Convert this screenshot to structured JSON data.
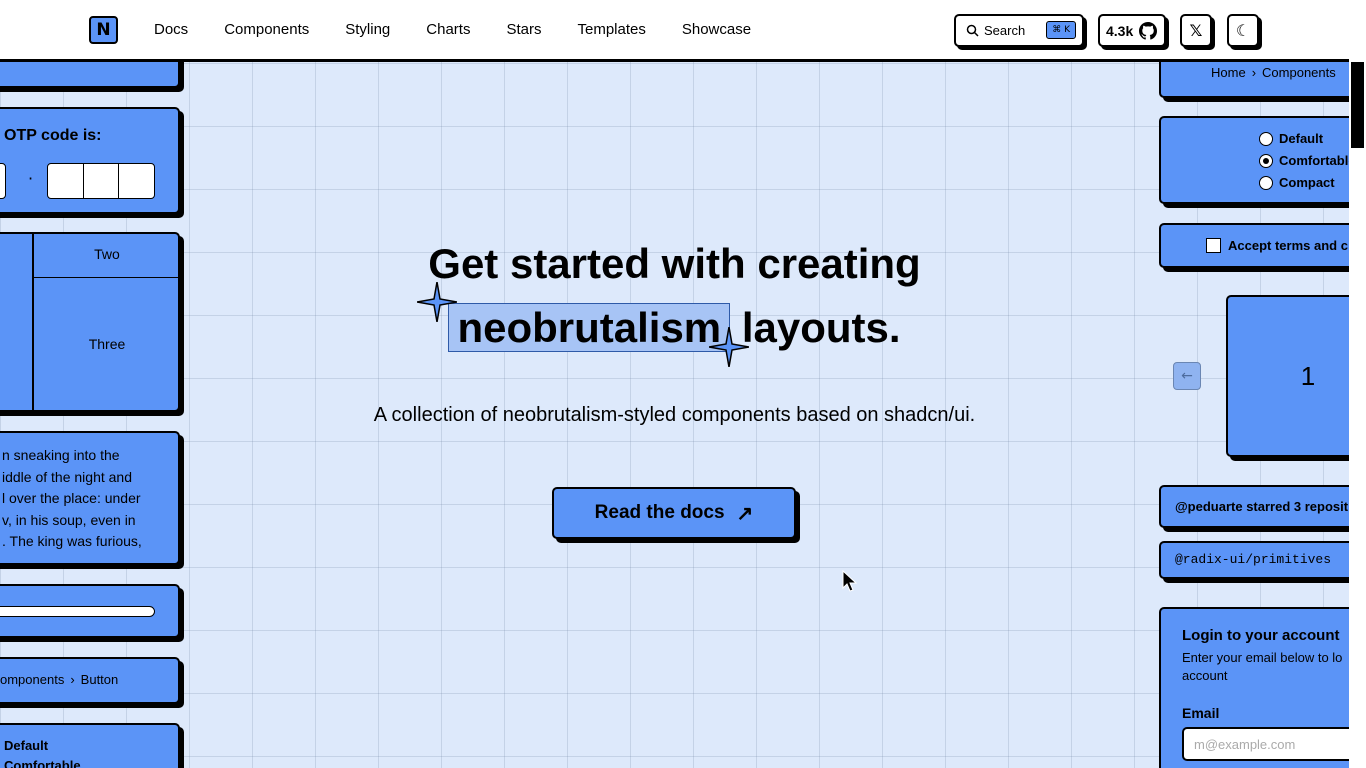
{
  "header": {
    "logo_text": "N",
    "nav": [
      "Docs",
      "Components",
      "Styling",
      "Charts",
      "Stars",
      "Templates",
      "Showcase"
    ],
    "search_label": "Search",
    "search_shortcut": "⌘ K",
    "github_stars": "4.3k",
    "x_label": "𝕏",
    "theme_icon": "☾"
  },
  "hero": {
    "title_line1": "Get started with creating",
    "title_highlight": "neobrutalism",
    "title_rest": "layouts.",
    "subtitle": "A collection of neobrutalism-styled components based on shadcn/ui.",
    "cta": "Read the docs",
    "cta_icon": "↗"
  },
  "left_panel": {
    "otp_label": "OTP code is:",
    "otp_sep": "·",
    "grid_two": "Two",
    "grid_three": "Three",
    "story_lines": [
      "n sneaking into the",
      "iddle of the night and",
      "l over the place: under",
      "v, in his soup, even in",
      ". The king was furious,"
    ],
    "breadcrumb_a": "omponents",
    "breadcrumb_sep": "›",
    "breadcrumb_b": "Button",
    "radio_1": "Default",
    "radio_2": "Comfortable"
  },
  "right_panel": {
    "breadcrumb_home": "Home",
    "breadcrumb_sep": "›",
    "breadcrumb_components": "Components",
    "radios": [
      "Default",
      "Comfortable",
      "Compact"
    ],
    "checkbox_label": "Accept terms and c",
    "carousel_value": "1",
    "carousel_prev": "←",
    "starred_text": "@peduarte starred 3 reposit",
    "repo_text": "@radix-ui/primitives",
    "login_title": "Login to your account",
    "login_desc": "Enter your email below to lo",
    "login_desc2": "account",
    "email_label": "Email",
    "email_placeholder": "m@example.com"
  }
}
